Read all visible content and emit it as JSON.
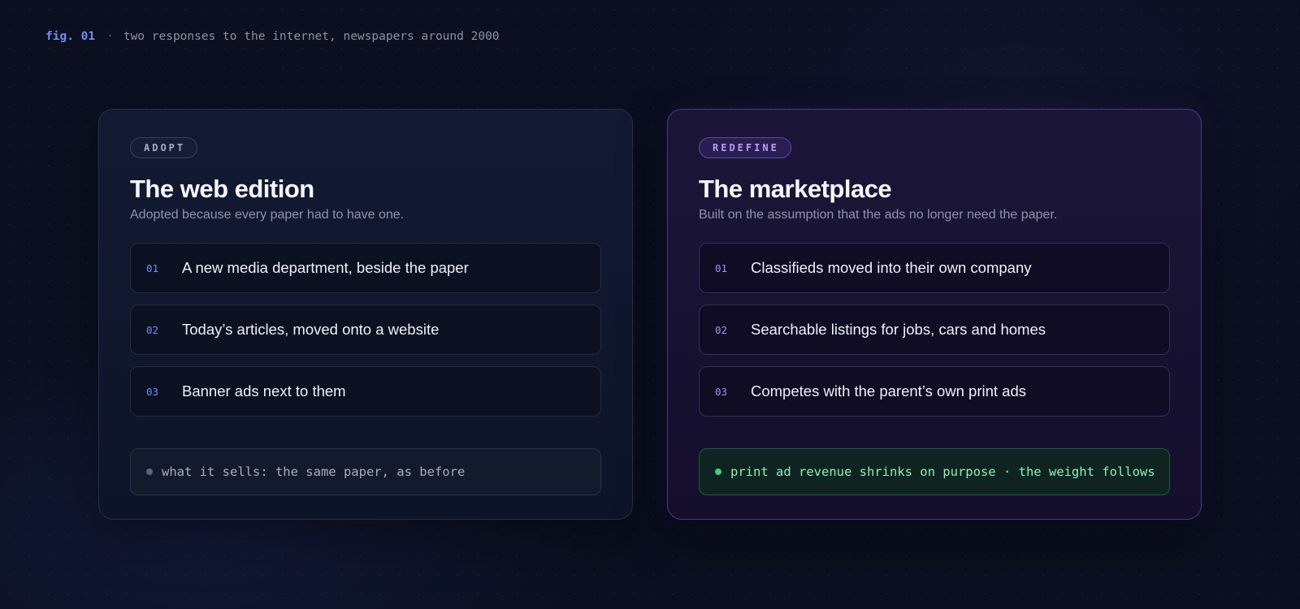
{
  "caption": {
    "fig": "fig. 01",
    "separator": "·",
    "text": "two responses to the internet, newspapers around 2000"
  },
  "cards": [
    {
      "tag": "ADOPT",
      "title": "The web edition",
      "subtitle": "Adopted because every paper had to have one.",
      "items": [
        {
          "num": "01",
          "text": "A new media department, beside the paper"
        },
        {
          "num": "02",
          "text": "Today’s articles, moved onto a website"
        },
        {
          "num": "03",
          "text": "Banner ads next to them"
        }
      ],
      "footer": "what it sells: the same paper, as before"
    },
    {
      "tag": "REDEFINE",
      "title": "The marketplace",
      "subtitle": "Built on the assumption that the ads no longer need the paper.",
      "items": [
        {
          "num": "01",
          "text": "Classifieds moved into their own company"
        },
        {
          "num": "02",
          "text": "Searchable listings for jobs, cars and homes"
        },
        {
          "num": "03",
          "text": "Competes with the parent’s own print ads"
        }
      ],
      "footer": "print ad revenue shrinks on purpose · the weight follows"
    }
  ],
  "colors": {
    "background": "#0b0f1f",
    "adopt_accent": "#6f8df5",
    "redefine_accent": "#b79cf5",
    "positive_green": "#3ecf78"
  }
}
